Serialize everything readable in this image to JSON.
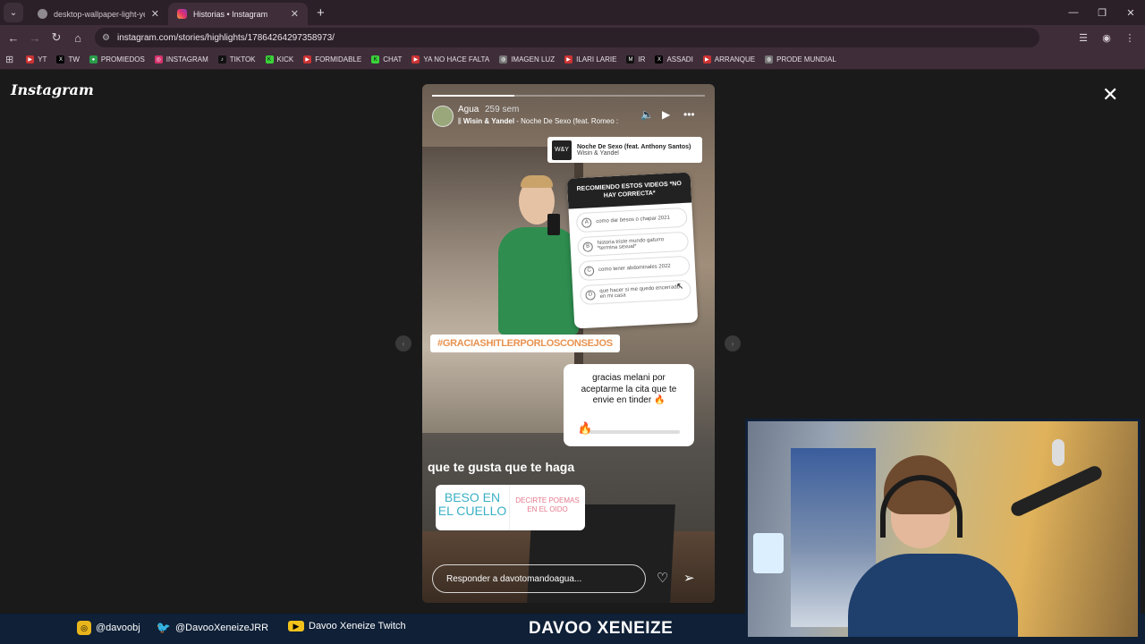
{
  "browser": {
    "tabs": [
      {
        "title": "desktop-wallpaper-light-yellow",
        "active": false
      },
      {
        "title": "Historias • Instagram",
        "active": true
      }
    ],
    "new_tab": "+",
    "url": "instagram.com/stories/highlights/17864264297358973/",
    "bookmarks": [
      "YT",
      "TW",
      "PROMIEDOS",
      "INSTAGRAM",
      "TIKTOK",
      "KICK",
      "FORMIDABLE",
      "CHAT",
      "YA NO HACE FALTA",
      "IMAGEN LUZ",
      "ILARI LARIE",
      "IR",
      "ASSADI",
      "ARRANQUE",
      "PRODE MUNDIAL"
    ]
  },
  "instagram": {
    "logo": "Instagram",
    "story": {
      "progress_fraction": 0.3,
      "username": "Agua",
      "time": "259 sem",
      "music_artist": "Wisin & Yandel",
      "music_track": " - Noche De Sexo (feat. Romeo :",
      "music_card": {
        "title": "Noche De Sexo (feat. Anthony Santos)",
        "artist": "Wisin & Yandel"
      },
      "quiz": {
        "question": "RECOMIENDO ESTOS VIDEOS *NO HAY CORRECTA*",
        "options": [
          {
            "letter": "A",
            "text": "como dar besos o chapar 2021"
          },
          {
            "letter": "B",
            "text": "historia triste mundo gaturro *termina sexual*"
          },
          {
            "letter": "C",
            "text": "como tener abdominales 2022"
          },
          {
            "letter": "D",
            "text": "que hacer si me quedo encerrado en mi casa"
          }
        ]
      },
      "hashtag": "#GRACIASHITLERPORLOSCONSEJOS",
      "slider": {
        "question": "gracias melani por aceptarme la cita que te envie en tinder 🔥",
        "emoji": "🔥",
        "value_fraction": 0.05
      },
      "caption": "que te gusta que te haga",
      "choice_a": "BESO EN EL CUELLO",
      "choice_b": "DECIRTE POEMAS EN EL OIDO",
      "reply_placeholder": "Responder a davotomandoagua..."
    }
  },
  "stream": {
    "instagram": "@davoobj",
    "twitter": "@DavooXeneizeJRR",
    "twitch": "Davoo Xeneize Twitch",
    "brand": "DAVOO XENEIZE"
  }
}
